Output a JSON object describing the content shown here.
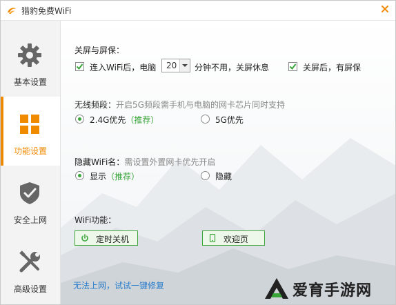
{
  "window": {
    "title": "猎豹免费WiFi"
  },
  "sidebar": {
    "items": [
      {
        "label": "基本设置",
        "icon": "gear-icon"
      },
      {
        "label": "功能设置",
        "icon": "grid-icon",
        "active": true
      },
      {
        "label": "安全上网",
        "icon": "shield-check-icon"
      },
      {
        "label": "高级设置",
        "icon": "tools-icon"
      }
    ]
  },
  "screen": {
    "title": "关屏与屏保：",
    "auto_rest_prefix": "连入WiFi后，电脑",
    "minutes_value": "20",
    "auto_rest_suffix": "分钟不用，关屏休息",
    "screensaver_label": "关屏后，有屏保"
  },
  "band": {
    "title": "无线频段：",
    "hint": "开启5G频段需手机与电脑的网卡芯片同时支持",
    "opt1": "2.4G优先",
    "opt1_tag": "（推荐）",
    "opt2": "5G优先"
  },
  "hide": {
    "title": "隐藏WiFi名：",
    "hint": "需设置外置网卡优先开启",
    "opt1": "显示",
    "opt1_tag": "（推荐）",
    "opt2": "隐藏"
  },
  "features": {
    "title": "WiFi功能：",
    "btn_timer": "定时关机",
    "btn_welcome": "欢迎页"
  },
  "footer": {
    "repair_link": "无法上网，试试一键修复"
  },
  "watermark": {
    "text": "爱育手游网"
  },
  "colors": {
    "accent_orange": "#f08a00",
    "accent_green": "#3aa63a",
    "link_blue": "#2b7cc9"
  }
}
